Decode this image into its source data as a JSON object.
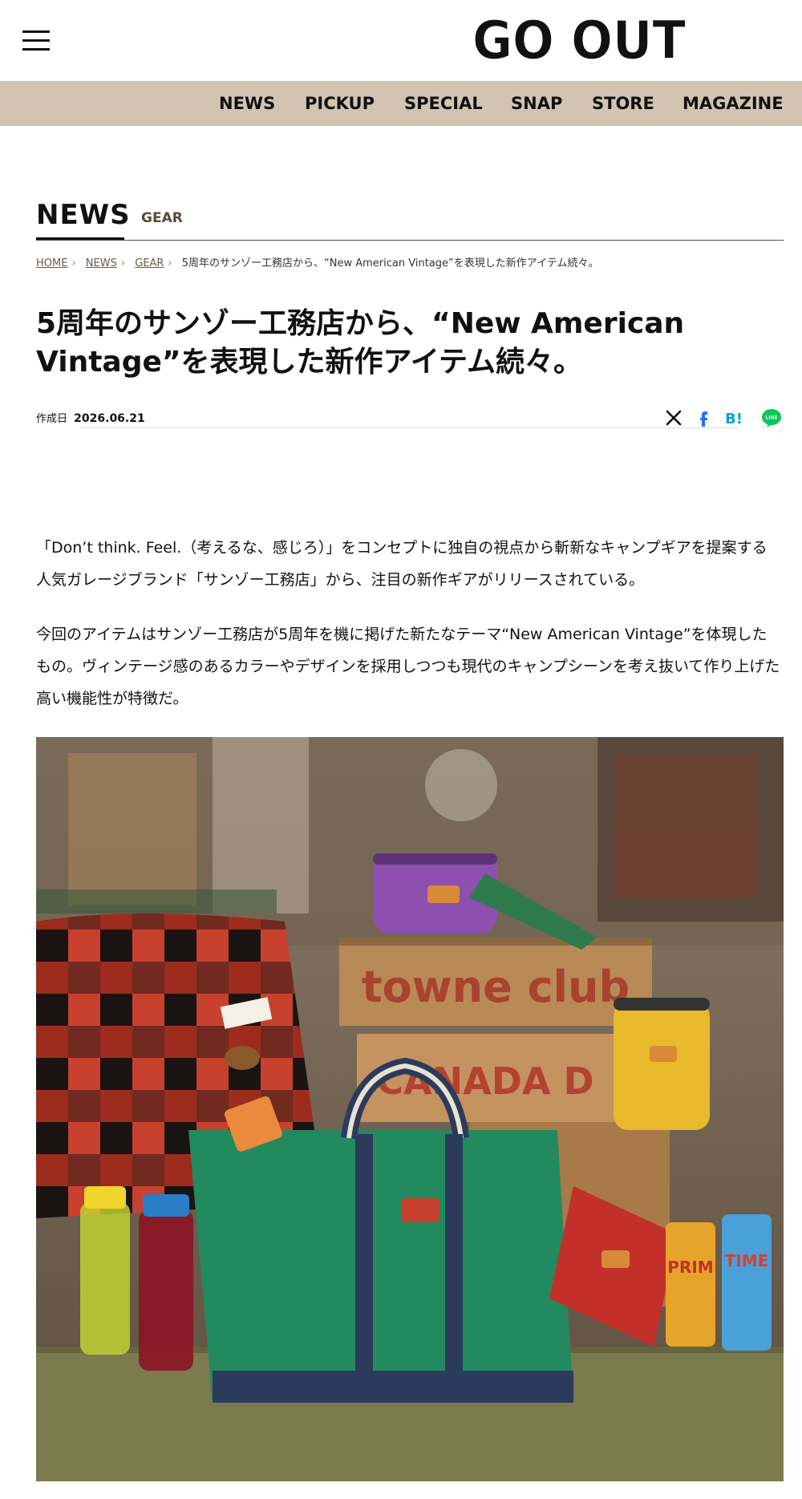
{
  "header": {
    "logo_text": "GO OUT",
    "menu_icon": "hamburger-menu-icon"
  },
  "nav": {
    "items": [
      "NEWS",
      "PICKUP",
      "SPECIAL",
      "SNAP",
      "STORE",
      "MAGAZINE"
    ],
    "background": "#d2c4b1"
  },
  "section": {
    "title": "NEWS",
    "category": "GEAR"
  },
  "breadcrumb": {
    "items": [
      "HOME",
      "NEWS",
      "GEAR"
    ],
    "current": "5周年のサンゾー工務店から、“New American Vintage”を表現した新作アイテム続々。"
  },
  "article": {
    "headline": "5周年のサンゾー工務店から、“New American Vintage”を表現した新作アイテム続々。",
    "created_label": "作成日",
    "created_date": "2026.06.21",
    "paragraphs": [
      "「Don’t think. Feel.（考えるな、感じろ）」をコンセプトに独自の視点から斬新なキャンプギアを提案する人気ガレージブランド「サンゾー工務店」から、注目の新作ギアがリリースされている。",
      "今回のアイテムはサンゾー工務店が5周年を機に掲げた新たなテーマ“New American Vintage”を体現したもの。ヴィンテージ感のあるカラーやデザインを採用しつつも現代のキャンプシーンを考え抜いて作り上げた高い機能性が特徴だ。"
    ],
    "photo_text": {
      "crate_top": "towne club",
      "crate_bottom": "CANADA D",
      "can_left": "PRIM",
      "can_right": "TIME"
    }
  },
  "share": {
    "icons": [
      "x-share-icon",
      "facebook-share-icon",
      "hatena-bookmark-icon",
      "line-share-icon"
    ],
    "hatena_label": "B!",
    "line_label": "LINE"
  },
  "colors": {
    "accent": "#5a4a35",
    "nav_bg": "#d2c4b1",
    "line_green": "#06c755",
    "facebook_blue": "#1877f2",
    "hatena_blue": "#00a4de"
  }
}
